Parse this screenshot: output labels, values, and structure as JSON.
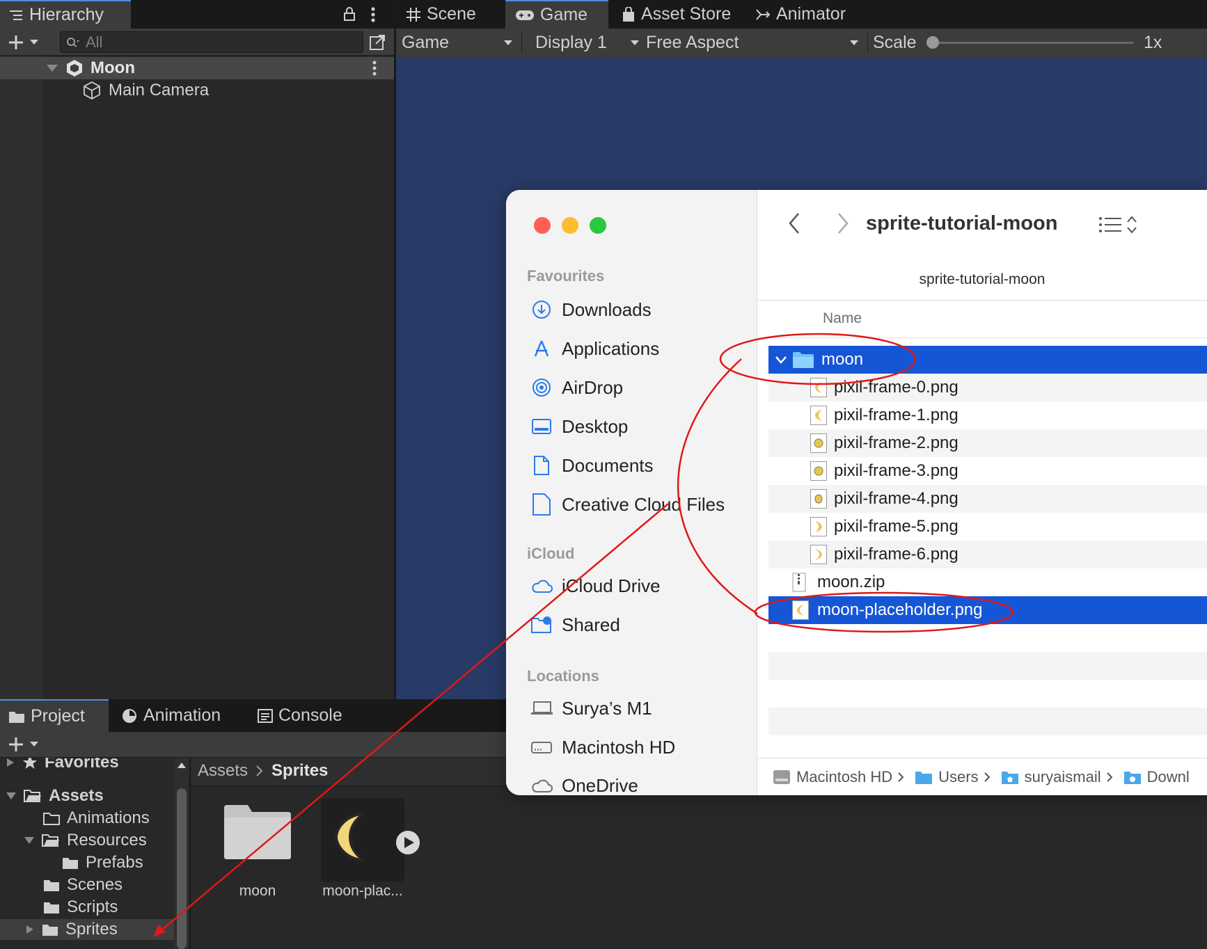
{
  "hierarchy": {
    "tab_label": "Hierarchy",
    "search_placeholder": "All",
    "root": "Moon",
    "child": "Main Camera"
  },
  "top_tabs": [
    {
      "label": "Scene",
      "icon": "grid-icon"
    },
    {
      "label": "Game",
      "icon": "gamepad-icon"
    },
    {
      "label": "Asset Store",
      "icon": "bag-icon"
    },
    {
      "label": "Animator",
      "icon": "animator-icon"
    }
  ],
  "game_toolbar": {
    "mode": "Game",
    "display": "Display 1",
    "aspect": "Free Aspect",
    "scale_label": "Scale",
    "scale_value": "1x"
  },
  "bottom_tabs": [
    {
      "label": "Project",
      "icon": "folder-icon"
    },
    {
      "label": "Animation",
      "icon": "clock-icon"
    },
    {
      "label": "Console",
      "icon": "console-icon"
    }
  ],
  "project": {
    "favorites_label": "Favorites",
    "tree": {
      "assets": "Assets",
      "animations": "Animations",
      "resources": "Resources",
      "prefabs": "Prefabs",
      "scenes": "Scenes",
      "scripts": "Scripts",
      "sprites": "Sprites"
    },
    "breadcrumb": {
      "first": "Assets",
      "second": "Sprites"
    },
    "grid_items": [
      {
        "label": "moon",
        "type": "folder"
      },
      {
        "label": "moon-plac...",
        "type": "sprite"
      }
    ]
  },
  "finder": {
    "title": "sprite-tutorial-moon",
    "path_title": "sprite-tutorial-moon",
    "column_header": "Name",
    "sidebar": {
      "favourites_heading": "Favourites",
      "favourites": [
        {
          "label": "Downloads",
          "icon": "download-icon"
        },
        {
          "label": "Applications",
          "icon": "applications-icon"
        },
        {
          "label": "AirDrop",
          "icon": "airdrop-icon"
        },
        {
          "label": "Desktop",
          "icon": "desktop-icon"
        },
        {
          "label": "Documents",
          "icon": "document-icon"
        },
        {
          "label": "Creative Cloud Files",
          "icon": "file-icon"
        }
      ],
      "icloud_heading": "iCloud",
      "icloud": [
        {
          "label": "iCloud Drive",
          "icon": "cloud-icon"
        },
        {
          "label": "Shared",
          "icon": "shared-folder-icon"
        }
      ],
      "locations_heading": "Locations",
      "locations": [
        {
          "label": "Surya’s M1",
          "icon": "laptop-icon"
        },
        {
          "label": "Macintosh HD",
          "icon": "drive-icon"
        },
        {
          "label": "OneDrive",
          "icon": "cloud-icon"
        }
      ]
    },
    "files": [
      {
        "name": "moon",
        "kind": "folder",
        "selected": true
      },
      {
        "name": "pixil-frame-0.png",
        "kind": "png"
      },
      {
        "name": "pixil-frame-1.png",
        "kind": "png"
      },
      {
        "name": "pixil-frame-2.png",
        "kind": "png"
      },
      {
        "name": "pixil-frame-3.png",
        "kind": "png"
      },
      {
        "name": "pixil-frame-4.png",
        "kind": "png"
      },
      {
        "name": "pixil-frame-5.png",
        "kind": "png"
      },
      {
        "name": "pixil-frame-6.png",
        "kind": "png"
      },
      {
        "name": "moon.zip",
        "kind": "zip"
      },
      {
        "name": "moon-placeholder.png",
        "kind": "png",
        "selected": true
      }
    ],
    "pathbar": [
      "Macintosh HD",
      "Users",
      "suryaismail",
      "Downl"
    ]
  },
  "colors": {
    "unity_bg": "#282828",
    "game_view": "#283a66",
    "finder_selection": "#1556d6",
    "annotation": "#e01818"
  }
}
